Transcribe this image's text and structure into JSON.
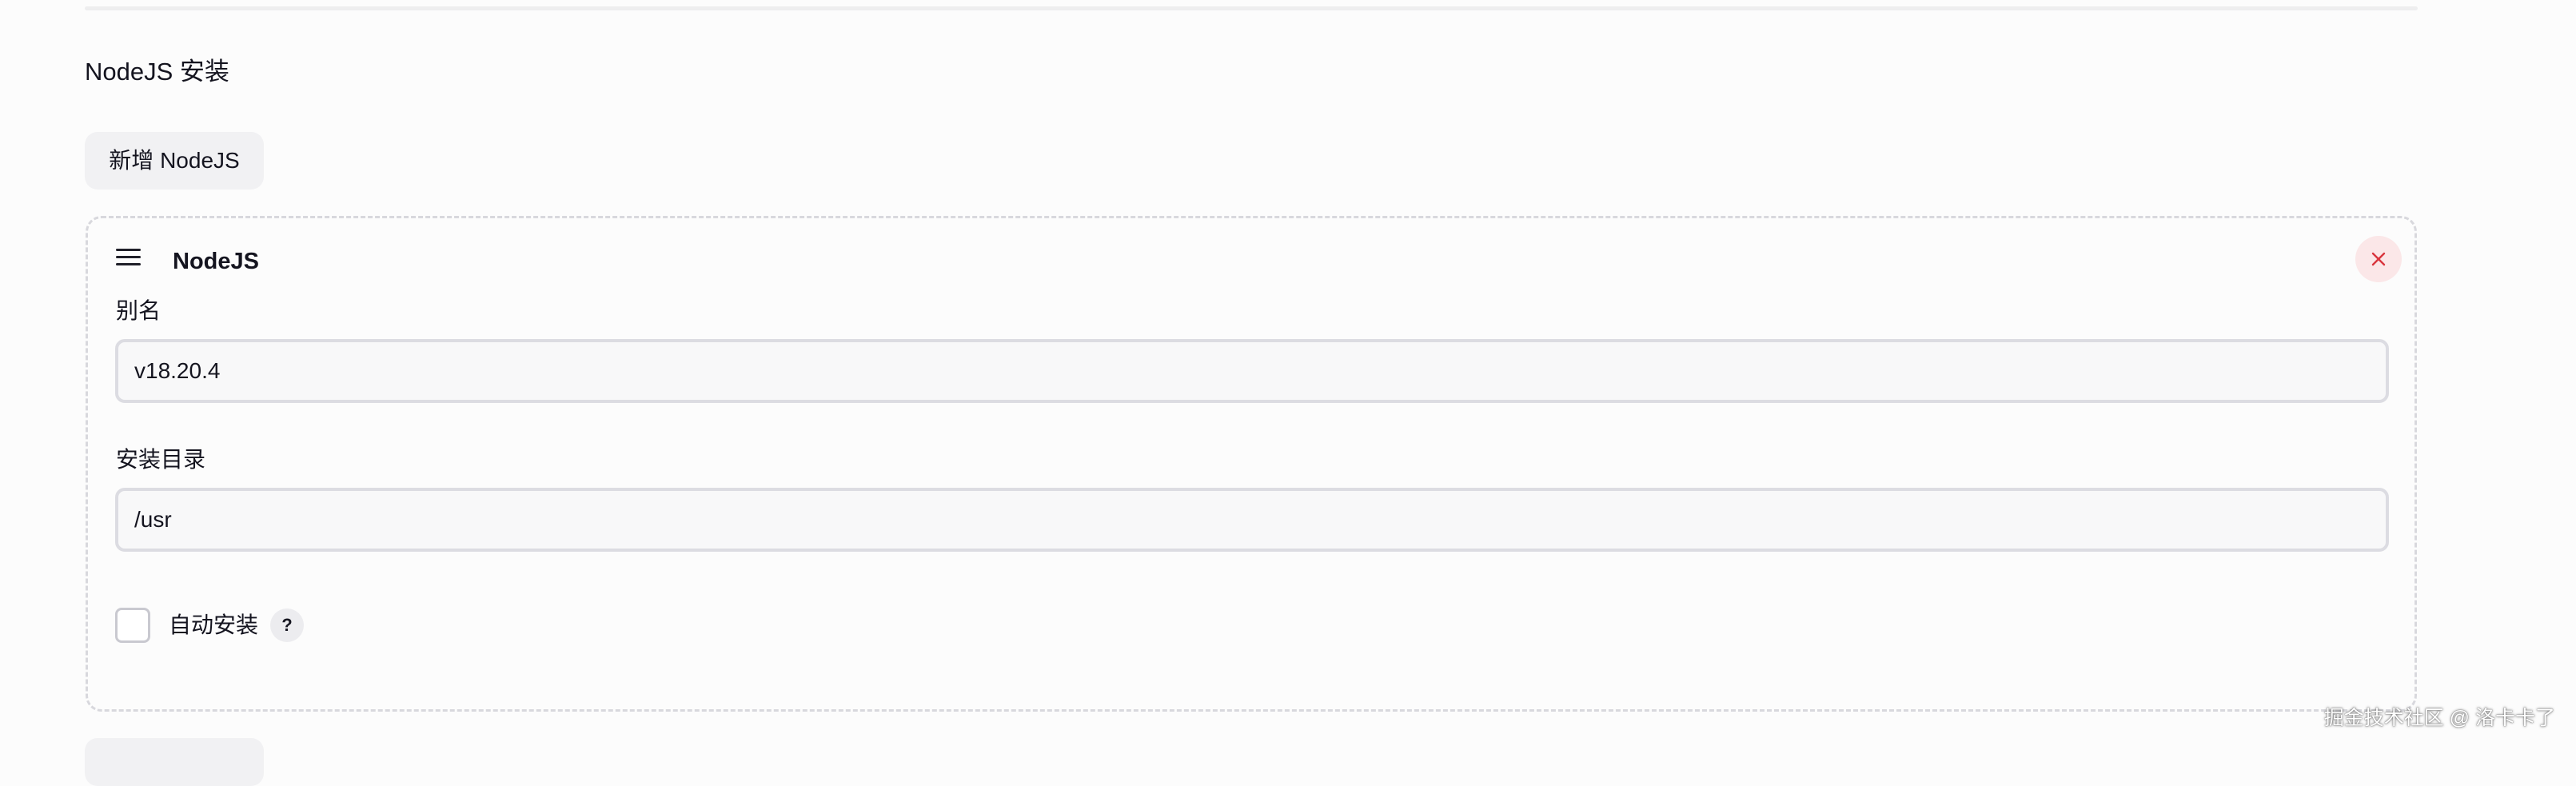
{
  "section": {
    "title": "NodeJS 安装",
    "add_button_label": "新增 NodeJS"
  },
  "card": {
    "title": "NodeJS",
    "alias_label": "别名",
    "alias_value": "v18.20.4",
    "install_dir_label": "安装目录",
    "install_dir_value": "/usr",
    "auto_install_label": "自动安装",
    "auto_install_checked": false,
    "help_label": "?"
  },
  "icons": {
    "drag_handle": "menu-icon",
    "delete": "close-icon"
  },
  "colors": {
    "delete_accent": "#d9363e",
    "delete_background": "#fbe7e8"
  },
  "watermark": "掘金技术社区 @ 洛卡卡了"
}
